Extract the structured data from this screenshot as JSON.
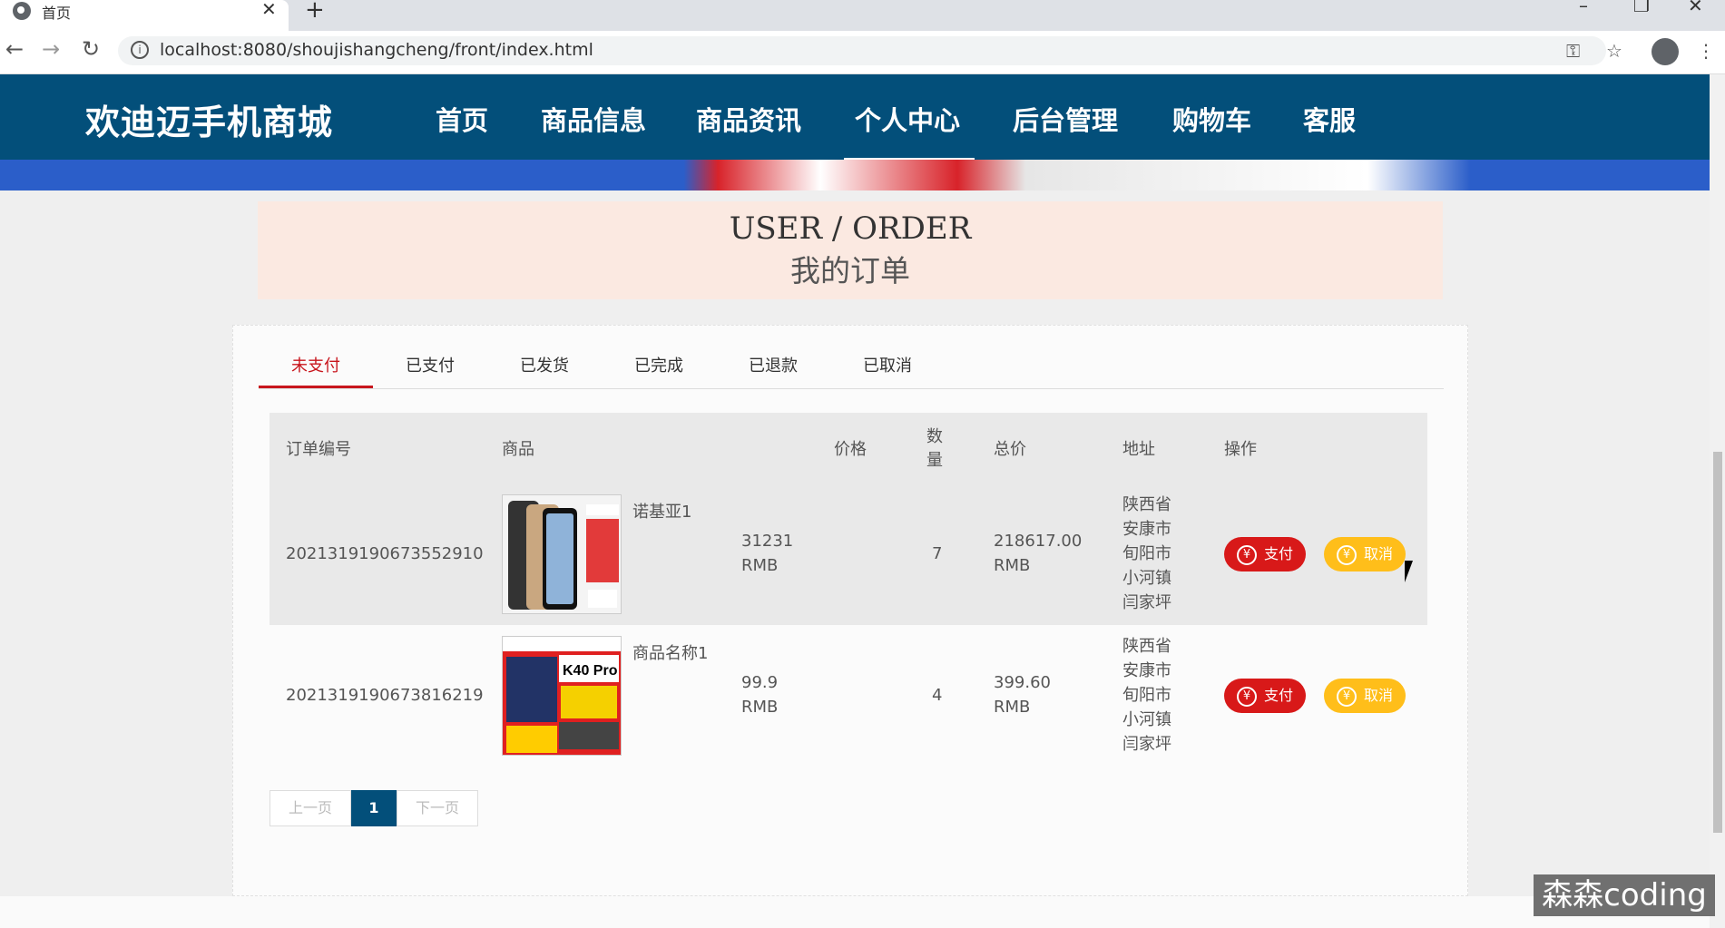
{
  "browser": {
    "tab_title": "首页",
    "url": "localhost:8080/shoujishangcheng/front/index.html"
  },
  "header": {
    "brand": "欢迪迈手机商城",
    "nav": [
      "首页",
      "商品信息",
      "商品资讯",
      "个人中心",
      "后台管理",
      "购物车",
      "客服"
    ],
    "active_nav": "个人中心"
  },
  "title": {
    "en": "USER / ORDER",
    "cn": "我的订单"
  },
  "order_tabs": [
    "未支付",
    "已支付",
    "已发货",
    "已完成",
    "已退款",
    "已取消"
  ],
  "active_tab": "未支付",
  "table": {
    "headers": {
      "order_no": "订单编号",
      "product": "商品",
      "price": "价格",
      "qty": "数量",
      "total": "总价",
      "address": "地址",
      "action": "操作"
    },
    "rows": [
      {
        "order_no": "2021319190673552910",
        "product": "诺基亚1",
        "price_value": "31231",
        "price_unit": "RMB",
        "qty": "7",
        "total_value": "218617.00",
        "total_unit": "RMB",
        "address_lines": [
          "陕西省",
          "安康市",
          "旬阳市",
          "小河镇",
          "闫家坪"
        ],
        "pay_label": "支付",
        "cancel_label": "取消"
      },
      {
        "order_no": "2021319190673816219",
        "product": "商品名称1",
        "price_value": "99.9",
        "price_unit": "RMB",
        "qty": "4",
        "total_value": "399.60",
        "total_unit": "RMB",
        "address_lines": [
          "陕西省",
          "安康市",
          "旬阳市",
          "小河镇",
          "闫家坪"
        ],
        "pay_label": "支付",
        "cancel_label": "取消"
      }
    ]
  },
  "pager": {
    "prev": "上一页",
    "current": "1",
    "next": "下一页"
  },
  "watermark": "森森coding",
  "colors": {
    "header_bg": "#034f7a",
    "accent_red": "#c8161d",
    "pay_button": "#d81919",
    "cancel_button": "#ffbe1a",
    "title_band": "#fbe9e1"
  }
}
